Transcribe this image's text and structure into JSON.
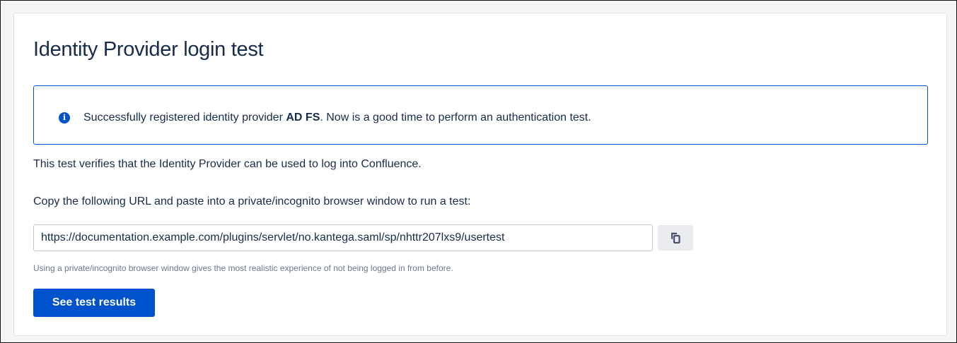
{
  "page": {
    "title": "Identity Provider login test"
  },
  "info": {
    "icon": "info-icon",
    "prefix": "Successfully registered identity provider ",
    "provider": "AD FS",
    "suffix": ". Now is a good time to perform an authentication test."
  },
  "content": {
    "description": "This test verifies that the Identity Provider can be used to log into Confluence.",
    "instruction": "Copy the following URL and paste into a private/incognito browser window to run a test:",
    "url_value": "https://documentation.example.com/plugins/servlet/no.kantega.saml/sp/nhttr207lxs9/usertest",
    "copy_icon": "copy-icon",
    "hint": "Using a private/incognito browser window gives the most realistic experience of not being logged in from before.",
    "button_label": "See test results"
  },
  "colors": {
    "accent": "#0052cc",
    "text": "#172b4d",
    "muted": "#6b778c",
    "border": "#dfe1e6"
  }
}
